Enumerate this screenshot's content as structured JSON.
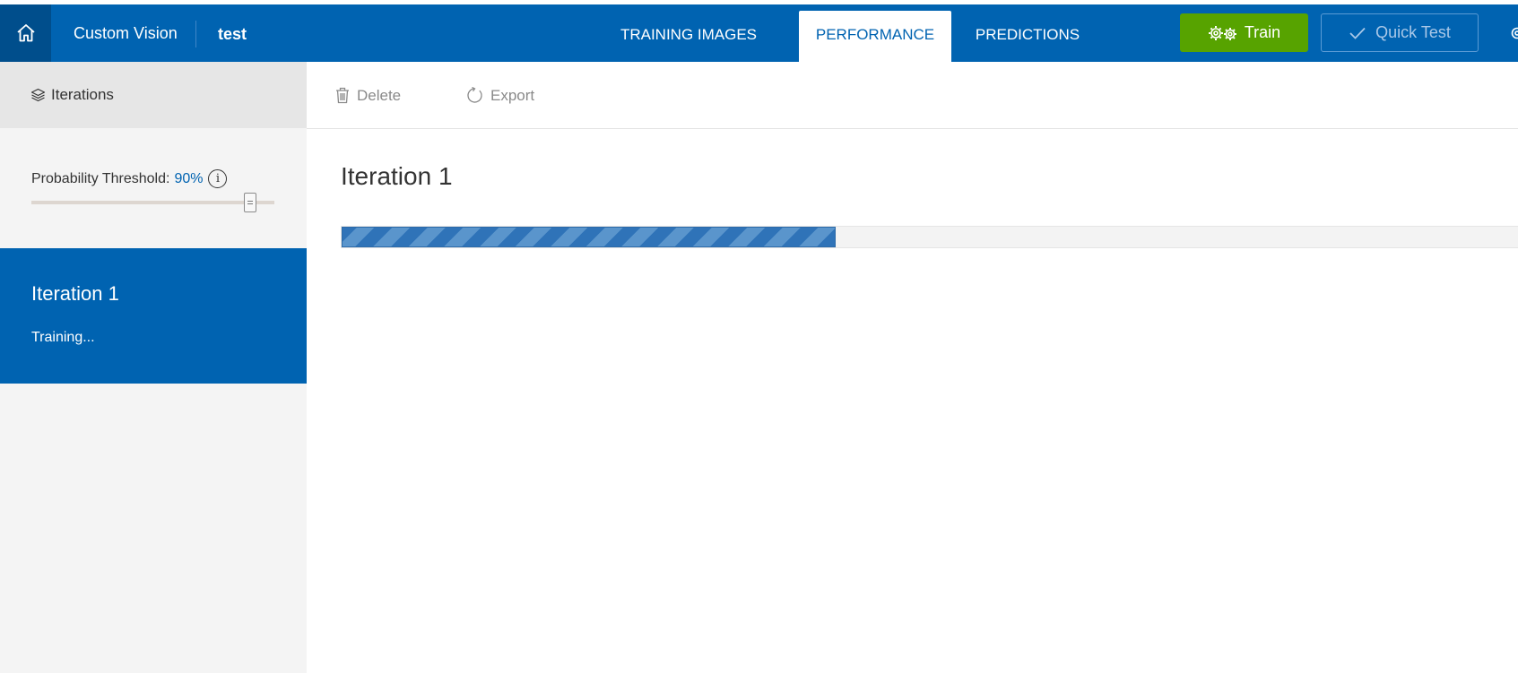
{
  "header": {
    "brand": "Custom Vision",
    "project": "test",
    "tabs": [
      {
        "label": "TRAINING IMAGES"
      },
      {
        "label": "PERFORMANCE"
      },
      {
        "label": "PREDICTIONS"
      }
    ],
    "active_tab": "PERFORMANCE",
    "train_label": "Train",
    "quick_test_label": "Quick Test"
  },
  "sidebar": {
    "title": "Iterations",
    "threshold_label": "Probability Threshold:",
    "threshold_value": "90%",
    "threshold_fraction": 0.9,
    "iterations": [
      {
        "name": "Iteration 1",
        "status": "Training..."
      }
    ]
  },
  "toolbar": {
    "delete_label": "Delete",
    "export_label": "Export"
  },
  "main": {
    "title": "Iteration 1",
    "progress_fraction": 0.42
  },
  "colors": {
    "header_blue": "#0063b1",
    "home_dark": "#004e8c",
    "train_green": "#57a300",
    "sidebar_bg": "#f4f4f4",
    "progress_stripe": "#2f73b8"
  }
}
